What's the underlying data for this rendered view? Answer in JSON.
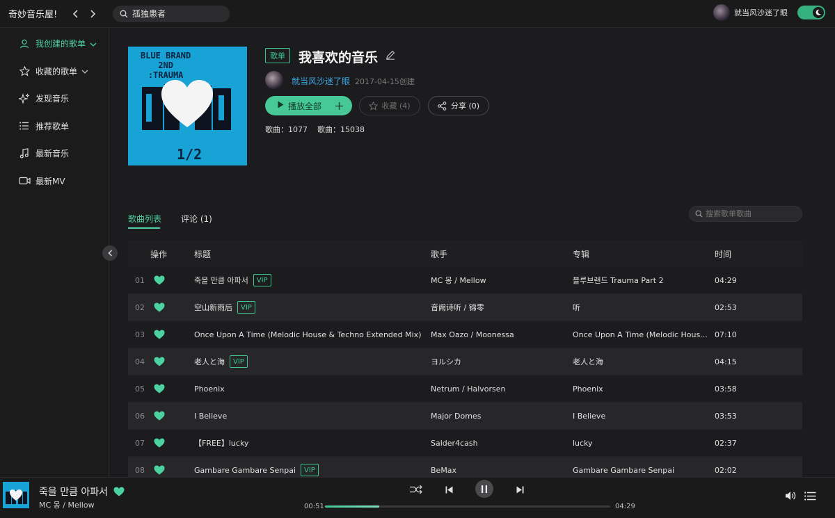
{
  "app": {
    "title": "奇妙音乐屋!"
  },
  "search": {
    "value": "孤独患者"
  },
  "user": {
    "name": "就当风沙迷了眼"
  },
  "sidebar": {
    "items": [
      {
        "label": "我创建的歌单",
        "icon": "user-icon",
        "active": true,
        "expandable": true
      },
      {
        "label": "收藏的歌单",
        "icon": "star-icon",
        "active": false,
        "expandable": true
      },
      {
        "label": "发现音乐",
        "icon": "sparkle-icon",
        "active": false,
        "expandable": false
      },
      {
        "label": "推荐歌单",
        "icon": "list-icon",
        "active": false,
        "expandable": false
      },
      {
        "label": "最新音乐",
        "icon": "music-note-icon",
        "active": false,
        "expandable": false
      },
      {
        "label": "最新MV",
        "icon": "video-icon",
        "active": false,
        "expandable": false
      }
    ]
  },
  "playlist": {
    "type_badge": "歌单",
    "title": "我喜欢的音乐",
    "creator": "就当风沙迷了眼",
    "created_at": "2017-04-15创建",
    "play_all_label": "播放全部",
    "collect_label": "收藏 (4)",
    "share_label": "分享 (0)",
    "song_count_label": "歌曲：",
    "song_count": "1077",
    "play_count_label": "歌曲：",
    "play_count": "15038",
    "cover_text": "BLUE BRAND\n2ND\n:TRAUMA",
    "cover_num": "1/2"
  },
  "tabs": [
    {
      "label": "歌曲列表",
      "active": true
    },
    {
      "label": "评论 (1)",
      "active": false
    }
  ],
  "list_search": {
    "placeholder": "搜索歌单歌曲"
  },
  "table": {
    "headers": {
      "op": "操作",
      "title": "标题",
      "artist": "歌手",
      "album": "专辑",
      "time": "时间"
    },
    "rows": [
      {
        "idx": "01",
        "title": "죽을 만큼 아파서",
        "vip": true,
        "artist": "MC 몽 / Mellow",
        "album": "블루브랜드 Trauma Part 2",
        "time": "04:29"
      },
      {
        "idx": "02",
        "title": "空山新雨后",
        "vip": true,
        "artist": "音阙诗听 / 锦零",
        "album": "听",
        "time": "02:53"
      },
      {
        "idx": "03",
        "title": "Once Upon A Time (Melodic House & Techno Extended Mix)",
        "vip": false,
        "artist": "Max Oazo / Moonessa",
        "album": "Once Upon A Time (Melodic Hous...",
        "time": "07:10"
      },
      {
        "idx": "04",
        "title": "老人と海",
        "vip": true,
        "artist": "ヨルシカ",
        "album": "老人と海",
        "time": "04:15"
      },
      {
        "idx": "05",
        "title": "Phoenix",
        "vip": false,
        "artist": "Netrum / Halvorsen",
        "album": "Phoenix",
        "time": "03:58"
      },
      {
        "idx": "06",
        "title": "I Believe",
        "vip": false,
        "artist": "Major Domes",
        "album": "I Believe",
        "time": "03:53"
      },
      {
        "idx": "07",
        "title": "【FREE】lucky",
        "vip": false,
        "artist": "Salder4cash",
        "album": "lucky",
        "time": "02:37"
      },
      {
        "idx": "08",
        "title": "Gambare Gambare Senpai",
        "vip": true,
        "artist": "BeMax",
        "album": "Gambare Gambare Senpai",
        "time": "02:02"
      }
    ],
    "vip_label": "VIP"
  },
  "player": {
    "title": "죽을 만큼 아파서",
    "artist": "MC 몽 / Mellow",
    "current_time": "00:51",
    "total_time": "04:29",
    "progress": 0.19
  },
  "colors": {
    "accent": "#47c897",
    "link": "#3aa6e3",
    "cover": "#17a3d6"
  }
}
